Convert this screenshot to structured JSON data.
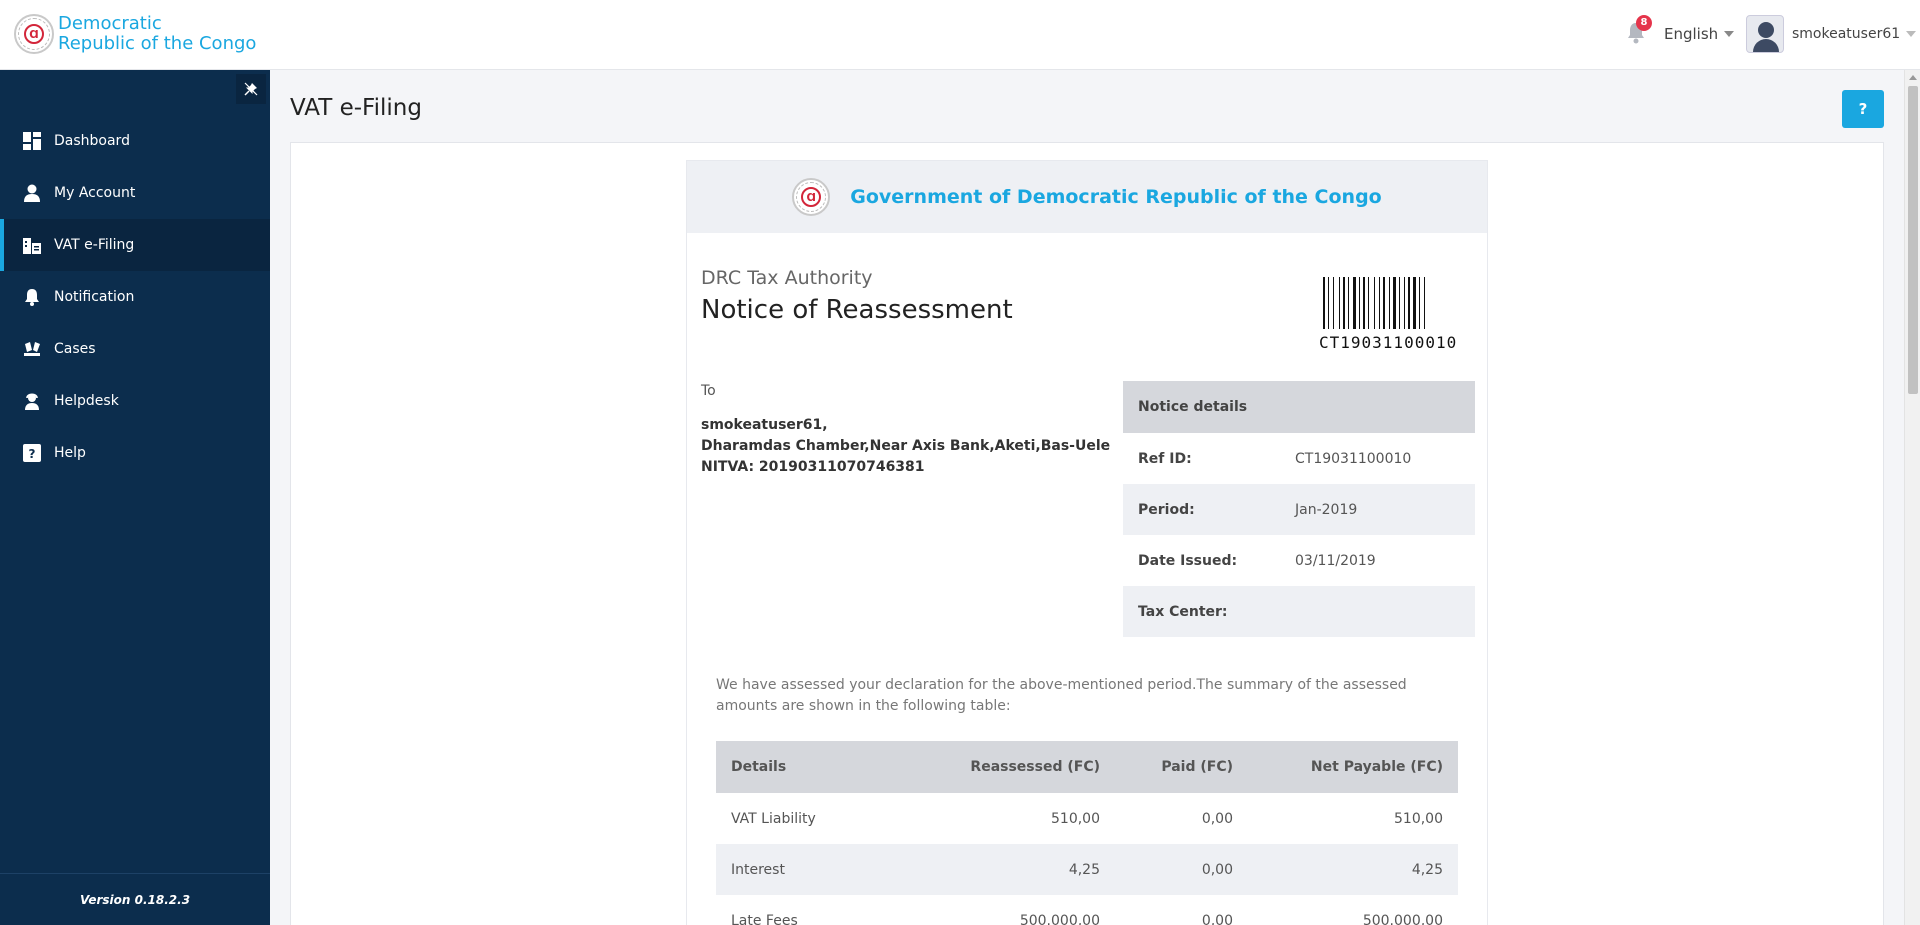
{
  "brand": {
    "line1": "Democratic",
    "line2": "Republic of the Congo",
    "seal_glyph": "Ɑ"
  },
  "header": {
    "notification_count": "8",
    "language": "English",
    "username": "smokeatuser61"
  },
  "sidebar": {
    "items": [
      {
        "label": "Dashboard",
        "icon": "dashboard-icon"
      },
      {
        "label": "My Account",
        "icon": "user-icon"
      },
      {
        "label": "VAT e-Filing",
        "icon": "vat-building-icon",
        "active": true
      },
      {
        "label": "Notification",
        "icon": "bell-icon"
      },
      {
        "label": "Cases",
        "icon": "cases-icon"
      },
      {
        "label": "Helpdesk",
        "icon": "helpdesk-icon"
      },
      {
        "label": "Help",
        "icon": "help-icon"
      }
    ],
    "version": "Version 0.18.2.3"
  },
  "page": {
    "title": "VAT e-Filing",
    "help_button": "?"
  },
  "notice": {
    "header": "Government of Democratic Republic of the Congo",
    "authority": "DRC Tax Authority",
    "title": "Notice of Reassessment",
    "barcode_text": "CT19031100010",
    "to_label": "To",
    "recipient": {
      "name": "smokeatuser61,",
      "address": "Dharamdas Chamber,Near Axis Bank,Aketi,Bas-Uele",
      "nitva": "NITVA: 20190311070746381"
    },
    "details": {
      "heading": "Notice details",
      "rows": [
        {
          "key": "Ref ID:",
          "value": "CT19031100010"
        },
        {
          "key": "Period:",
          "value": "Jan-2019"
        },
        {
          "key": "Date Issued:",
          "value": "03/11/2019"
        },
        {
          "key": "Tax Center:",
          "value": ""
        }
      ]
    },
    "summary": "We have assessed your declaration for the above-mentioned period.The summary of the assessed amounts are shown in the following table:",
    "table": {
      "headers": [
        "Details",
        "Reassessed (FC)",
        "Paid (FC)",
        "Net Payable (FC)"
      ],
      "rows": [
        [
          "VAT Liability",
          "510,00",
          "0,00",
          "510,00"
        ],
        [
          "Interest",
          "4,25",
          "0,00",
          "4,25"
        ],
        [
          "Late Fees",
          "500.000,00",
          "0,00",
          "500.000,00"
        ]
      ]
    }
  },
  "colors": {
    "accent": "#1aa7e0",
    "sidebar": "#0c2d4d",
    "badge": "#e5344b"
  }
}
